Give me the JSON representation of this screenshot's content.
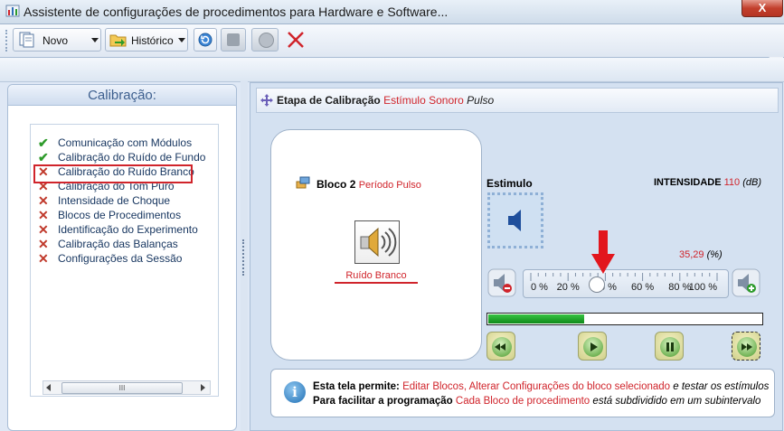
{
  "window": {
    "title": "Assistente de configurações de procedimentos para Hardware e Software...",
    "close_label": "X"
  },
  "toolbar": {
    "new_label": "Novo",
    "history_label": "Histórico"
  },
  "sidebar": {
    "title": "Calibração:",
    "items": [
      {
        "label": "Comunicação com Módulos",
        "status": "done"
      },
      {
        "label": "Calibração do Ruído de Fundo",
        "status": "done"
      },
      {
        "label": "Calibração do Ruído Branco",
        "status": "pending"
      },
      {
        "label": "Calibração do Tom Puro",
        "status": "pending"
      },
      {
        "label": "Intensidade de Choque",
        "status": "pending"
      },
      {
        "label": "Blocos de Procedimentos",
        "status": "pending"
      },
      {
        "label": "Identificação do Experimento",
        "status": "pending"
      },
      {
        "label": "Calibração das Balanças",
        "status": "pending"
      },
      {
        "label": "Configurações da Sessão",
        "status": "pending"
      }
    ],
    "selected_index": 2,
    "scroll_thumb": "III"
  },
  "step": {
    "label": "Etapa de Calibração",
    "stimulus": "Estímulo",
    "type": "Sonoro",
    "mode": "Pulso"
  },
  "block": {
    "label": "Bloco",
    "number": "2",
    "period": "Período Pulso",
    "noise_label": "Ruído Branco"
  },
  "stimulus_panel": {
    "title": "Estimulo",
    "intensity_label": "INTENSIDADE",
    "intensity_value": "110",
    "intensity_unit": "(dB)",
    "percent_value": "35,29",
    "percent_unit": "(%)",
    "slider_ticks": [
      "0 %",
      "20 %",
      "40 %",
      "60 %",
      "80 %",
      "100 %"
    ],
    "slider_value_percent": 35.29,
    "progress_fraction": 0.35
  },
  "info": {
    "line1_bold": "Esta tela permite:",
    "line1_red": "Editar Blocos, Alterar Configurações do bloco selecionado",
    "line1_it": "e testar os estímulos",
    "line2_bold": "Para facilitar a programação",
    "line2_red": "Cada Bloco de procedimento",
    "line2_it": "está subdividido em um subintervalo"
  },
  "colors": {
    "accent_red": "#d0242b",
    "check_green": "#2e9b2b",
    "progress_green": "#1fa52b"
  }
}
